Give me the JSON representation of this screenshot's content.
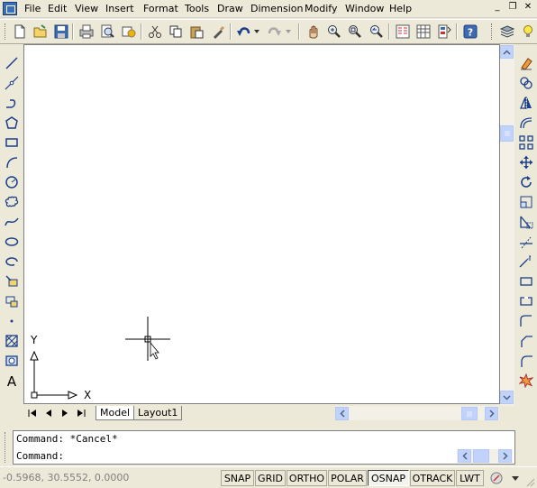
{
  "menu": {
    "items": [
      "File",
      "Edit",
      "View",
      "Insert",
      "Format",
      "Tools",
      "Draw",
      "Dimension",
      "Modify",
      "Window",
      "Help"
    ]
  },
  "window_controls": {
    "minimize": "_",
    "restore": "❐",
    "close": "✕"
  },
  "toolbar": {
    "icons": [
      "new-icon",
      "open-icon",
      "save-icon",
      "plot-icon",
      "plot-preview-icon",
      "publish-icon",
      "cut-icon",
      "copy-icon",
      "paste-icon",
      "match-properties-icon",
      "undo-icon",
      "redo-icon",
      "pan-icon",
      "zoom-realtime-icon",
      "zoom-window-icon",
      "zoom-previous-icon",
      "properties-icon",
      "design-center-icon",
      "tool-palettes-icon",
      "help-icon",
      "layers-icon",
      "layer-bulb-icon"
    ]
  },
  "draw_toolbar": {
    "icons": [
      "line-icon",
      "construction-line-icon",
      "polyline-icon",
      "polygon-icon",
      "rectangle-icon",
      "arc-icon",
      "circle-icon",
      "revision-cloud-icon",
      "spline-icon",
      "ellipse-icon",
      "ellipse-arc-icon",
      "insert-block-icon",
      "make-block-icon",
      "point-icon",
      "hatch-icon",
      "region-icon",
      "multiline-text-icon"
    ]
  },
  "modify_toolbar": {
    "icons": [
      "erase-icon",
      "copy-object-icon",
      "mirror-icon",
      "offset-icon",
      "array-icon",
      "move-icon",
      "rotate-icon",
      "scale-icon",
      "stretch-icon",
      "trim-icon",
      "extend-icon",
      "break-at-point-icon",
      "break-icon",
      "join-icon",
      "chamfer-icon",
      "fillet-icon",
      "explode-icon"
    ]
  },
  "ucs": {
    "x_label": "X",
    "y_label": "Y"
  },
  "layout_tabs": {
    "tabs": [
      {
        "label": "Model",
        "active": true
      },
      {
        "label": "Layout1",
        "active": false
      }
    ]
  },
  "command": {
    "history": "Command: *Cancel*",
    "prompt": "Command:"
  },
  "status": {
    "coordinates": "-0.5968, 30.5552, 0.0000",
    "toggles": [
      {
        "label": "SNAP",
        "on": false
      },
      {
        "label": "GRID",
        "on": false
      },
      {
        "label": "ORTHO",
        "on": false
      },
      {
        "label": "POLAR",
        "on": false
      },
      {
        "label": "OSNAP",
        "on": true
      },
      {
        "label": "OTRACK",
        "on": false
      },
      {
        "label": "LWT",
        "on": false
      }
    ]
  }
}
